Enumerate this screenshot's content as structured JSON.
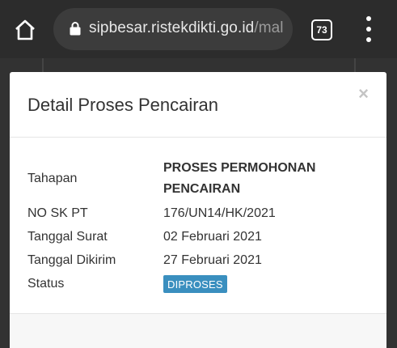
{
  "browser": {
    "url_main": "sipbesar.ristekdikti.go.id",
    "url_rest": "/mal",
    "tab_count": "73",
    "icons": {
      "home": "home-icon",
      "lock": "lock-icon",
      "tabs": "tabs-counter-icon",
      "menu": "kebab-menu-icon"
    }
  },
  "modal": {
    "title": "Detail Proses Pencairan",
    "close_label": "×",
    "rows": [
      {
        "label": "Tahapan",
        "value": "PROSES PERMOHONAN PENCAIRAN"
      },
      {
        "label": "NO SK PT",
        "value": "176/UN14/HK/2021"
      },
      {
        "label": "Tanggal Surat",
        "value": "02 Februari 2021"
      },
      {
        "label": "Tanggal Dikirim",
        "value": "27 Februari 2021"
      },
      {
        "label": "Status",
        "value": "DIPROSES"
      }
    ],
    "status_color": "#3a8fbf"
  }
}
